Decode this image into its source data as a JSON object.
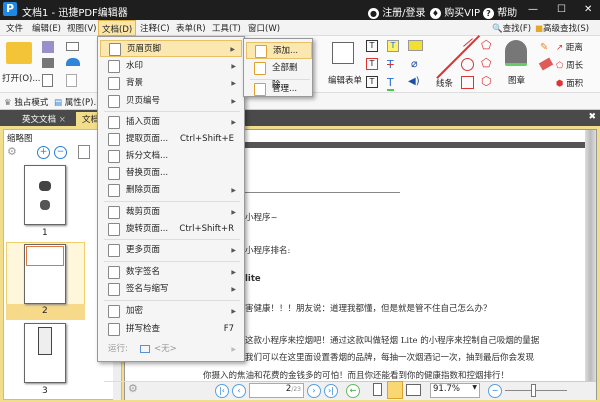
{
  "window": {
    "title": "文档1 - 迅捷PDF编辑器",
    "logo": "P",
    "register": "注册/登录",
    "buy_vip": "购买VIP",
    "help": "帮助",
    "minimize": "—",
    "maximize": "☐",
    "close": "✕"
  },
  "menubar": [
    "文件",
    "编辑(E)",
    "视图(V)",
    "文档(D)",
    "注释(C)",
    "表单(R)",
    "工具(T)",
    "窗口(W)"
  ],
  "ribbon": {
    "open": "打开(O)...",
    "edit_form": "编辑表单",
    "lines": "线条",
    "stamp": "图章",
    "distance": "距离",
    "perimeter": "周长",
    "area": "面积",
    "find": "查找(F)",
    "advanced_find": "高级查找(S)"
  },
  "toolbar2": {
    "exclusive_mode": "独占模式",
    "properties": "属性(P)..."
  },
  "tabs": [
    {
      "label": "英文文档"
    },
    {
      "label": "文档1"
    }
  ],
  "thumbnails": {
    "title": "缩略图",
    "pages": [
      "1",
      "2",
      "3"
    ],
    "selected": "2"
  },
  "doc_menu": {
    "items": [
      {
        "label": "页眉页脚",
        "arrow": true,
        "icon": "header-footer-icon"
      },
      {
        "label": "水印",
        "arrow": true,
        "icon": "watermark-icon"
      },
      {
        "label": "背景",
        "arrow": true,
        "icon": "background-icon"
      },
      {
        "label": "贝页编号",
        "arrow": true,
        "icon": "page-number-icon"
      },
      {
        "label": "插入页面",
        "arrow": true,
        "icon": "insert-page-icon"
      },
      {
        "label": "提取页面...",
        "shortcut": "Ctrl+Shift+E",
        "icon": "extract-page-icon"
      },
      {
        "label": "拆分文档...",
        "icon": "split-doc-icon"
      },
      {
        "label": "替换页面...",
        "icon": "replace-page-icon"
      },
      {
        "label": "删除页面",
        "arrow": true,
        "icon": "delete-page-icon"
      },
      {
        "label": "裁剪页面",
        "arrow": true,
        "icon": "crop-page-icon"
      },
      {
        "label": "旋转页面...",
        "shortcut": "Ctrl+Shift+R",
        "icon": "rotate-page-icon"
      },
      {
        "label": "更多页面",
        "arrow": true,
        "icon": "more-pages-icon"
      },
      {
        "label": "数字签名",
        "arrow": true,
        "icon": "digital-signature-icon"
      },
      {
        "label": "签名与缩写",
        "arrow": true,
        "icon": "sign-initial-icon"
      },
      {
        "label": "加密",
        "arrow": true,
        "icon": "encrypt-icon"
      },
      {
        "label": "拼写检查",
        "shortcut": "F7",
        "icon": "spell-check-icon"
      }
    ],
    "run_label": "运行:",
    "run_value": "<无>"
  },
  "submenu": [
    "添加...",
    "全部删除...",
    "管理..."
  ],
  "document": {
    "lines": [
      "小程序~",
      "小程序排名:",
      "lite",
      "害健康！！！朋友说：道理我都懂，但是就是管不住自己怎么办？",
      "这款小程序来控烟吧！通过这款叫做轻烟 Lite 的小程序来控制自己吸烟的量据",
      "我们可以在这里面设置香烟的品牌，每抽一次烟酒记一次，抽到最后你会发现",
      "你摄入的焦油和花费的金钱多的可怕！而且你还能看到你的健康指数和控烟排行！"
    ]
  },
  "navbar": {
    "page_current": "2",
    "page_total": "/23",
    "zoom": "91.7%"
  }
}
